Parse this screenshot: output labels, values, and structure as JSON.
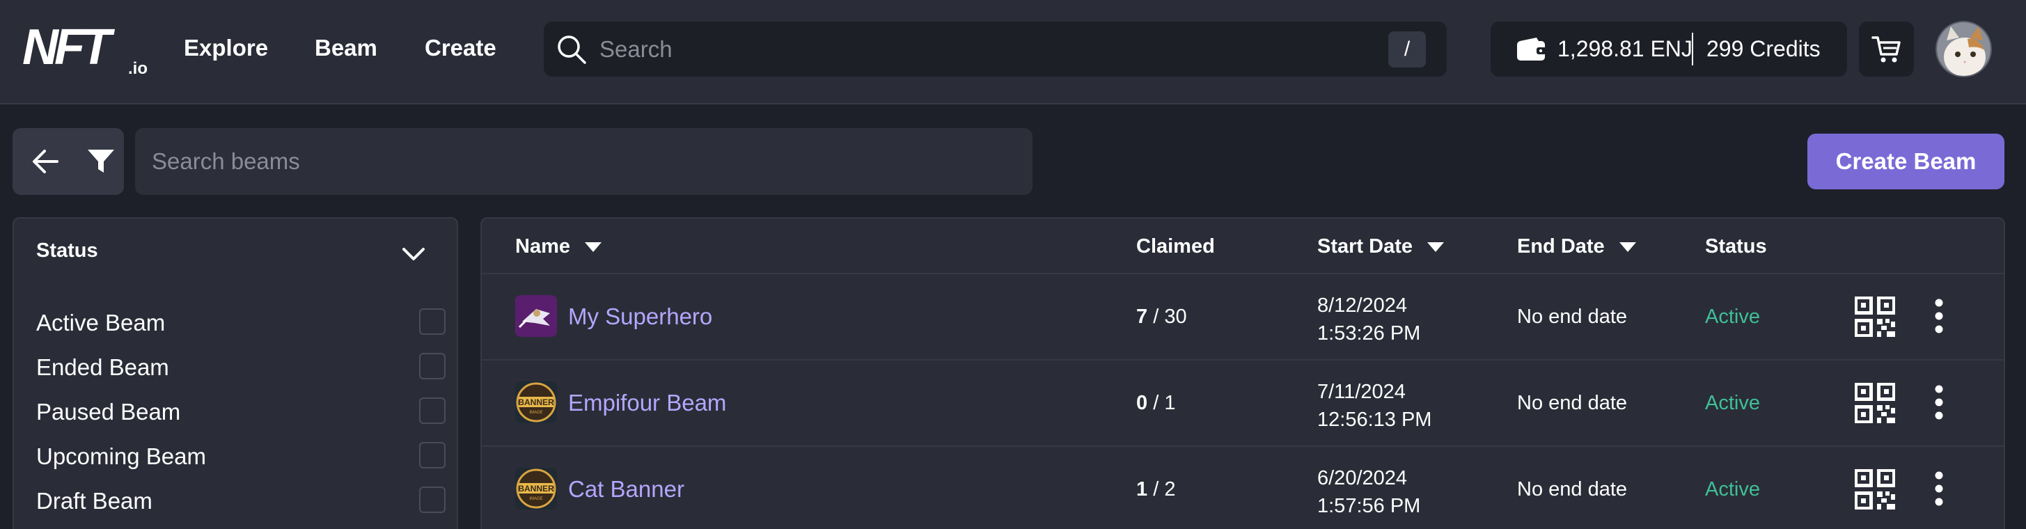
{
  "header": {
    "logo_text": "NFT.io",
    "nav": [
      "Explore",
      "Beam",
      "Create"
    ],
    "search": {
      "placeholder": "Search",
      "shortcut": "/"
    },
    "wallet": {
      "enj": "1,298.81 ENJ",
      "credits": "299 Credits"
    },
    "icons": {
      "search": "search-icon",
      "wallet": "wallet-icon",
      "cart": "cart-icon",
      "avatar": "cat-avatar"
    }
  },
  "toolbar": {
    "search_placeholder": "Search beams",
    "create_label": "Create Beam",
    "icons": {
      "back": "arrow-left-icon",
      "filter": "filter-icon"
    }
  },
  "filters": {
    "title": "Status",
    "items": [
      {
        "label": "Active Beam",
        "checked": false
      },
      {
        "label": "Ended Beam",
        "checked": false
      },
      {
        "label": "Paused Beam",
        "checked": false
      },
      {
        "label": "Upcoming Beam",
        "checked": false
      },
      {
        "label": "Draft Beam",
        "checked": false
      }
    ]
  },
  "table": {
    "columns": [
      "Name",
      "Claimed",
      "Start Date",
      "End Date",
      "Status"
    ],
    "sortable_columns": [
      "Name",
      "Start Date",
      "End Date"
    ],
    "rows": [
      {
        "name": "My Superhero",
        "claimed": "7",
        "total": "/ 30",
        "start_date": "8/12/2024",
        "start_time": "1:53:26 PM",
        "end_date": "No end date",
        "status": "Active",
        "thumb": "superhero-thumb"
      },
      {
        "name": "Empifour Beam",
        "claimed": "0",
        "total": "/ 1",
        "start_date": "7/11/2024",
        "start_time": "12:56:13 PM",
        "end_date": "No end date",
        "status": "Active",
        "thumb": "banner-thumb"
      },
      {
        "name": "Cat Banner",
        "claimed": "1",
        "total": "/ 2",
        "start_date": "6/20/2024",
        "start_time": "1:57:56 PM",
        "end_date": "No end date",
        "status": "Active",
        "thumb": "banner-thumb"
      }
    ]
  },
  "colors": {
    "background": "#1e2029",
    "header": "#2a2d37",
    "accent": "#7a6ad6",
    "link": "#b5a6ff",
    "status_active": "#3fbf9a"
  }
}
